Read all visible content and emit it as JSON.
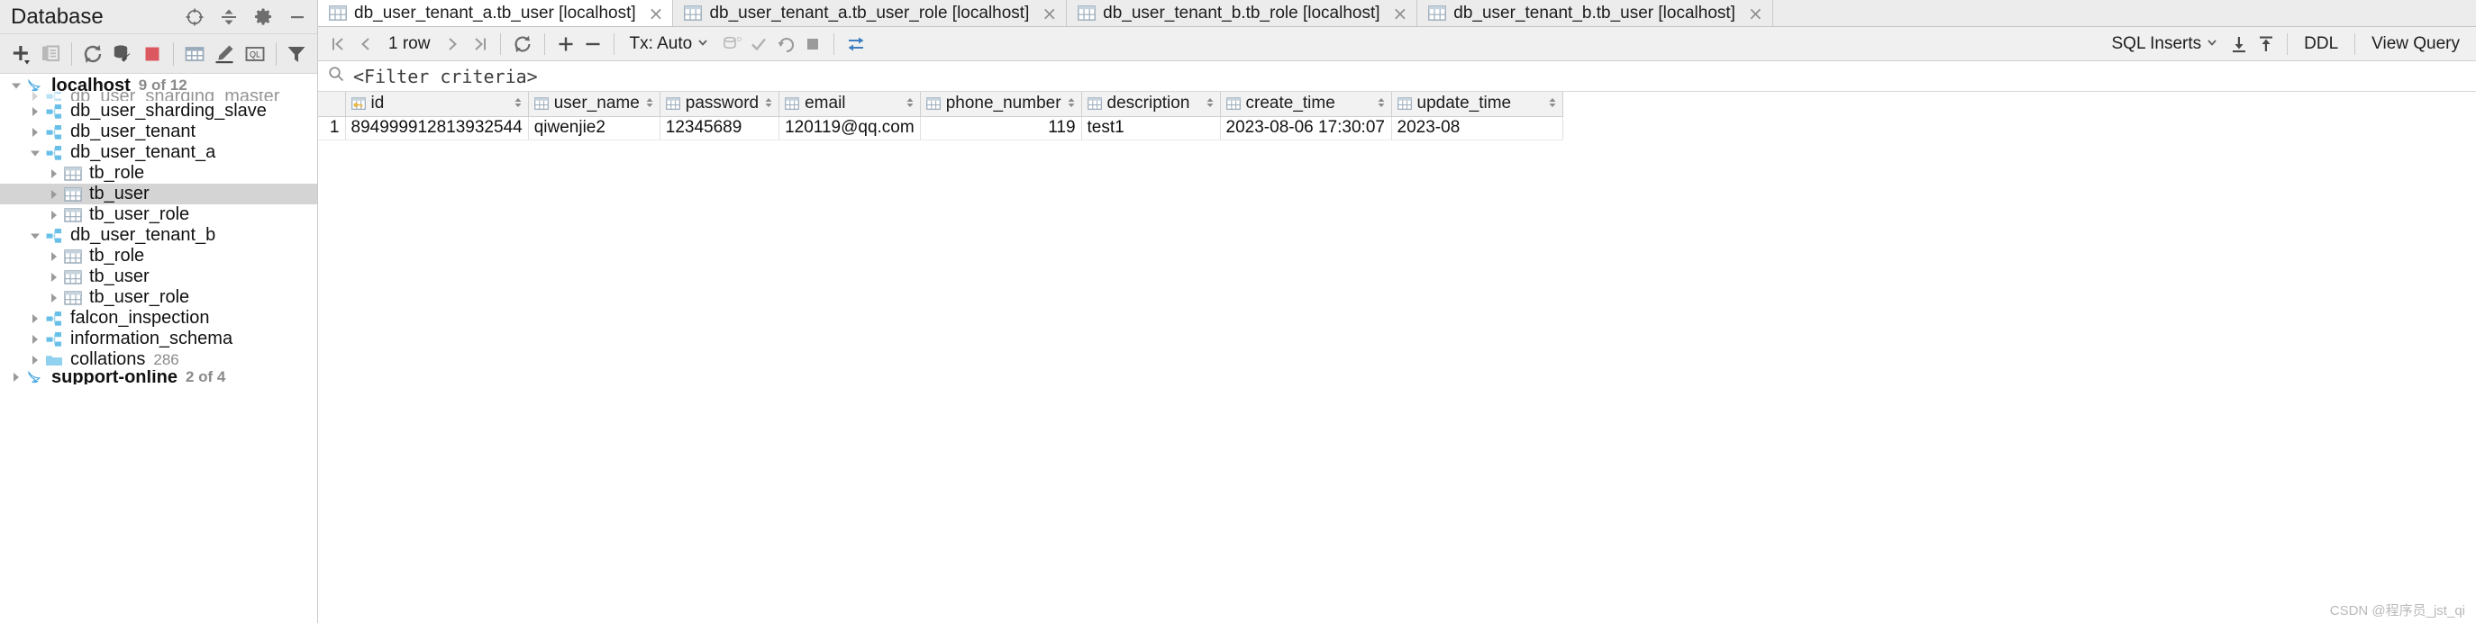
{
  "sidebar": {
    "title": "Database",
    "titlebar_icons": [
      {
        "name": "locate-crosshair-icon",
        "label": "Scroll from Source"
      },
      {
        "name": "collapse-all-icon",
        "label": "Collapse All"
      },
      {
        "name": "gear-icon",
        "label": "Settings"
      },
      {
        "name": "minimize-icon",
        "label": "Hide"
      }
    ],
    "toolbar_icons": [
      {
        "name": "add-plus-icon",
        "label": "New"
      },
      {
        "name": "duplicate-icon",
        "label": "Duplicate"
      },
      {
        "name": "refresh-icon",
        "label": "Refresh"
      },
      {
        "name": "db-tools-icon",
        "label": "Database Tools"
      },
      {
        "name": "stop-icon",
        "label": "Stop"
      },
      {
        "name": "table-icon",
        "label": "Table Editor"
      },
      {
        "name": "modify-pencil-icon",
        "label": "Modify"
      },
      {
        "name": "query-console-icon",
        "label": "Query Console"
      },
      {
        "name": "filter-funnel-icon",
        "label": "Filter"
      }
    ],
    "tree": [
      {
        "label": "localhost",
        "count": "9 of 12",
        "icon": "dolphin-icon",
        "depth": 0,
        "expanded": true,
        "arrow": "down",
        "selected": false,
        "root": true
      },
      {
        "label": "db_user_sharding_master",
        "count": "",
        "icon": "schema-icon",
        "depth": 1,
        "expanded": false,
        "arrow": "right",
        "selected": false,
        "clipped": true
      },
      {
        "label": "db_user_sharding_slave",
        "count": "",
        "icon": "schema-icon",
        "depth": 1,
        "expanded": false,
        "arrow": "right",
        "selected": false
      },
      {
        "label": "db_user_tenant",
        "count": "",
        "icon": "schema-icon",
        "depth": 1,
        "expanded": false,
        "arrow": "right",
        "selected": false
      },
      {
        "label": "db_user_tenant_a",
        "count": "",
        "icon": "schema-icon",
        "depth": 1,
        "expanded": true,
        "arrow": "down",
        "selected": false
      },
      {
        "label": "tb_role",
        "count": "",
        "icon": "table-icon",
        "depth": 2,
        "expanded": false,
        "arrow": "right",
        "selected": false
      },
      {
        "label": "tb_user",
        "count": "",
        "icon": "table-icon",
        "depth": 2,
        "expanded": false,
        "arrow": "right",
        "selected": true
      },
      {
        "label": "tb_user_role",
        "count": "",
        "icon": "table-icon",
        "depth": 2,
        "expanded": false,
        "arrow": "right",
        "selected": false
      },
      {
        "label": "db_user_tenant_b",
        "count": "",
        "icon": "schema-icon",
        "depth": 1,
        "expanded": true,
        "arrow": "down",
        "selected": false
      },
      {
        "label": "tb_role",
        "count": "",
        "icon": "table-icon",
        "depth": 2,
        "expanded": false,
        "arrow": "right",
        "selected": false
      },
      {
        "label": "tb_user",
        "count": "",
        "icon": "table-icon",
        "depth": 2,
        "expanded": false,
        "arrow": "right",
        "selected": false
      },
      {
        "label": "tb_user_role",
        "count": "",
        "icon": "table-icon",
        "depth": 2,
        "expanded": false,
        "arrow": "right",
        "selected": false
      },
      {
        "label": "falcon_inspection",
        "count": "",
        "icon": "schema-icon",
        "depth": 1,
        "expanded": false,
        "arrow": "right",
        "selected": false
      },
      {
        "label": "information_schema",
        "count": "",
        "icon": "schema-icon",
        "depth": 1,
        "expanded": false,
        "arrow": "right",
        "selected": false
      },
      {
        "label": "collations",
        "count": "286",
        "icon": "folder-icon",
        "depth": 1,
        "expanded": false,
        "arrow": "right",
        "selected": false
      },
      {
        "label": "support-online",
        "count": "2 of 4",
        "icon": "dolphin-icon",
        "depth": 0,
        "expanded": false,
        "arrow": "right",
        "selected": false,
        "root": true,
        "clipped": true
      }
    ]
  },
  "tabs": [
    {
      "label": "db_user_tenant_a.tb_user [localhost]",
      "active": true,
      "icon": "table-icon"
    },
    {
      "label": "db_user_tenant_a.tb_user_role [localhost]",
      "active": false,
      "icon": "table-icon"
    },
    {
      "label": "db_user_tenant_b.tb_role [localhost]",
      "active": false,
      "icon": "table-icon"
    },
    {
      "label": "db_user_tenant_b.tb_user [localhost]",
      "active": false,
      "icon": "table-icon"
    }
  ],
  "result_toolbar": {
    "first_page": "first-page-icon",
    "prev_page": "prev-page-icon",
    "row_count": "1 row",
    "next_page": "next-page-icon",
    "last_page": "last-page-icon",
    "reload": "refresh-icon",
    "add_row": "add-row-icon",
    "delete_row": "delete-row-icon",
    "tx_label": "Tx: Auto",
    "db_badge": "db-badge-icon",
    "commit": "commit-check-icon",
    "rollback": "rollback-icon",
    "cancel": "stop-square-icon",
    "transpose": "transpose-icon",
    "sql_inserts": "SQL Inserts",
    "download": "download-icon",
    "upload": "upload-icon",
    "ddl": "DDL",
    "view_query": "View Query"
  },
  "filter": {
    "icon": "search-icon",
    "placeholder": "<Filter criteria>",
    "value": "<Filter criteria>"
  },
  "grid": {
    "columns": [
      {
        "label": "id",
        "icon": "key-column-icon",
        "width": 115,
        "sortable": true
      },
      {
        "label": "user_name",
        "icon": "column-icon",
        "width": 132,
        "sortable": true
      },
      {
        "label": "password",
        "icon": "column-icon",
        "width": 132,
        "sortable": true
      },
      {
        "label": "email",
        "icon": "column-icon",
        "width": 139,
        "sortable": true
      },
      {
        "label": "phone_number",
        "icon": "column-icon",
        "width": 167,
        "sortable": true
      },
      {
        "label": "description",
        "icon": "column-icon",
        "width": 154,
        "sortable": true
      },
      {
        "label": "create_time",
        "icon": "column-icon",
        "width": 190,
        "sortable": true
      },
      {
        "label": "update_time",
        "icon": "column-icon",
        "width": 190,
        "sortable": true
      }
    ],
    "rows": [
      {
        "num": "1",
        "cells": [
          {
            "value": "894999912813932544",
            "align": "right"
          },
          {
            "value": "qiwenjie2",
            "align": "left"
          },
          {
            "value": "12345689",
            "align": "left"
          },
          {
            "value": "120119@qq.com",
            "align": "left"
          },
          {
            "value": "119",
            "align": "right"
          },
          {
            "value": "test1",
            "align": "left"
          },
          {
            "value": "2023-08-06 17:30:07",
            "align": "left"
          },
          {
            "value": "2023-08",
            "align": "left"
          }
        ]
      }
    ]
  },
  "watermark": "CSDN @程序员_jst_qi",
  "colors": {
    "accent_blue": "#68c0e8",
    "stop_red": "#db5860",
    "selection_gray": "#d4d4d4",
    "toolbar_bg": "#ebebeb"
  }
}
